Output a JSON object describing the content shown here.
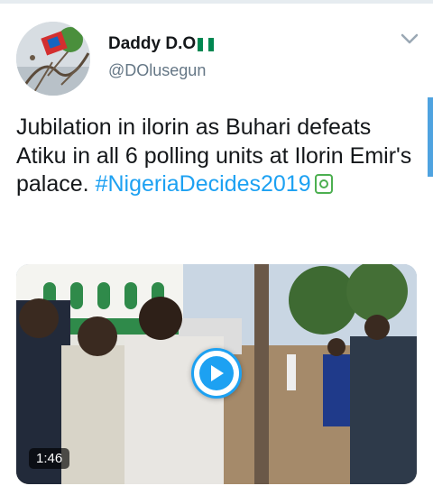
{
  "tweet": {
    "author": {
      "display_name": "Daddy D.O",
      "handle": "@DOlusegun",
      "flag_colors": [
        "#008751",
        "#ffffff",
        "#008751"
      ]
    },
    "text_main": "Jubilation in ilorin as Buhari defeats Atiku in all 6 polling units at Ilorin Emir's palace.",
    "hashtag": "#NigeriaDecides2019",
    "emoji_icon": "phone-emoji-icon",
    "menu_icon": "chevron-down-icon"
  },
  "video": {
    "duration": "1:46",
    "play_icon": "play-icon"
  },
  "colors": {
    "accent": "#1da1f2",
    "secondary_text": "#657786",
    "primary_text": "#14171a",
    "scroll_indicator": "#4fa3e0"
  }
}
